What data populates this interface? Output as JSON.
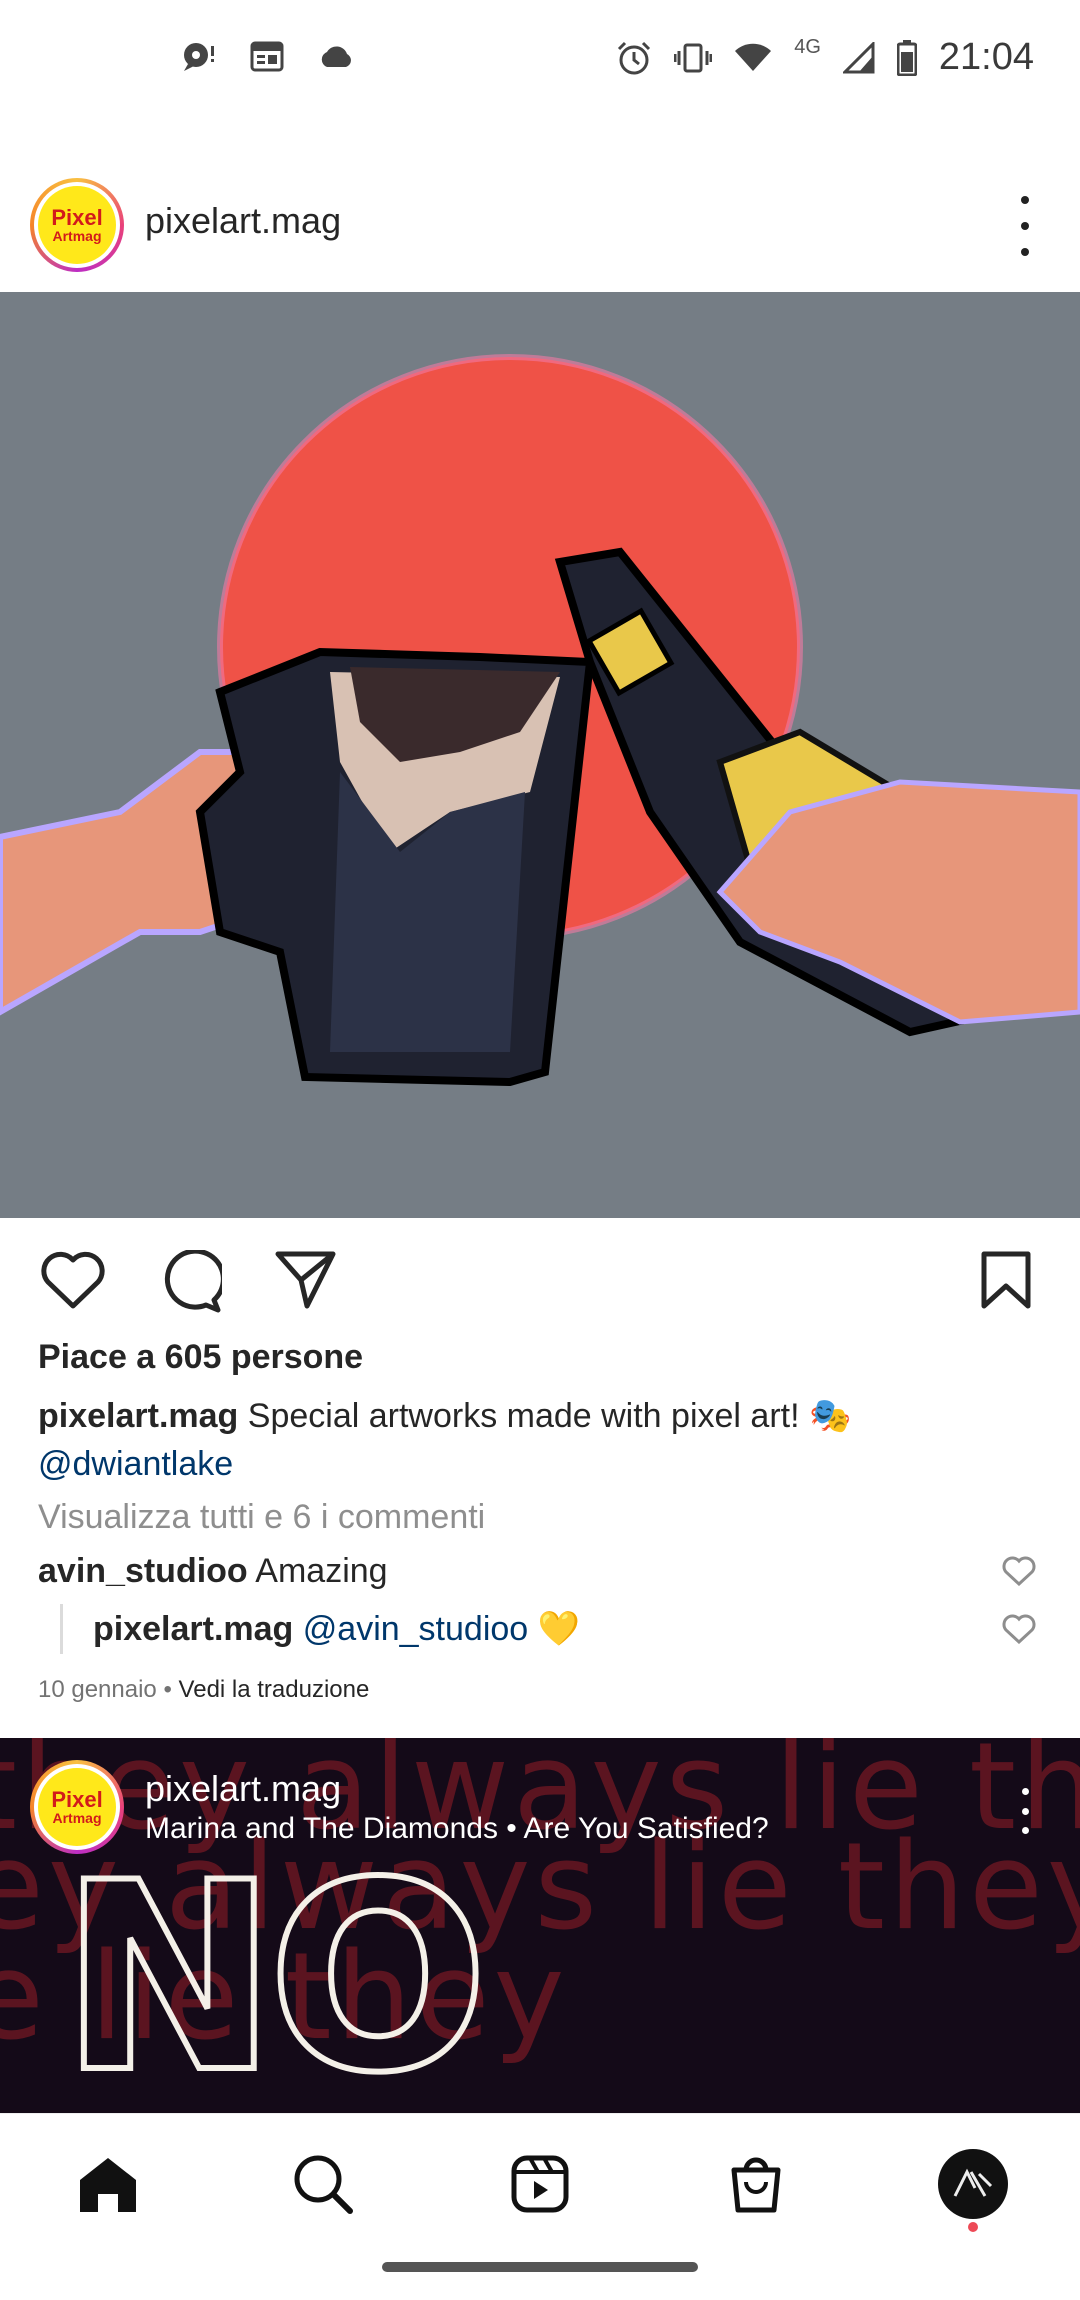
{
  "status_bar": {
    "time": "21:04",
    "network": "4G",
    "icons": [
      "chat-bubble-icon",
      "calendar-icon",
      "cloud-icon",
      "alarm-icon",
      "vibrate-icon",
      "wifi-icon",
      "signal-icon",
      "battery-icon"
    ]
  },
  "post": {
    "username": "pixelart.mag",
    "avatar_text_1": "Pixel",
    "avatar_text_2": "Artmag",
    "likes": "Piace a 605 persone",
    "caption_user": "pixelart.mag",
    "caption_text": "Special artworks made with pixel art! 🎭",
    "caption_mention": "@dwiantlake",
    "view_all_comments": "Visualizza tutti e 6 i commenti",
    "comments": [
      {
        "user": "avin_studioo",
        "text": "Amazing"
      },
      {
        "user": "pixelart.mag",
        "mention": "@avin_studioo",
        "text": "💛"
      }
    ],
    "date": "10 gennaio",
    "separator": "•",
    "translate": "Vedi la traduzione"
  },
  "reel": {
    "username": "pixelart.mag",
    "song": "Marina and The Diamonds • Are You Satisfied?",
    "bg_text": [
      "they always lie  they al",
      "ey always lie  they a",
      "e     lie  they"
    ],
    "overlay_text": "NO"
  },
  "nav": {
    "items": [
      "home-icon",
      "search-icon",
      "reels-icon",
      "shop-icon",
      "profile-avatar"
    ]
  },
  "colors": {
    "mention": "#00376b",
    "muted": "#8e8e8e",
    "image_bg": "#757d85",
    "sun": "#ef5247"
  }
}
